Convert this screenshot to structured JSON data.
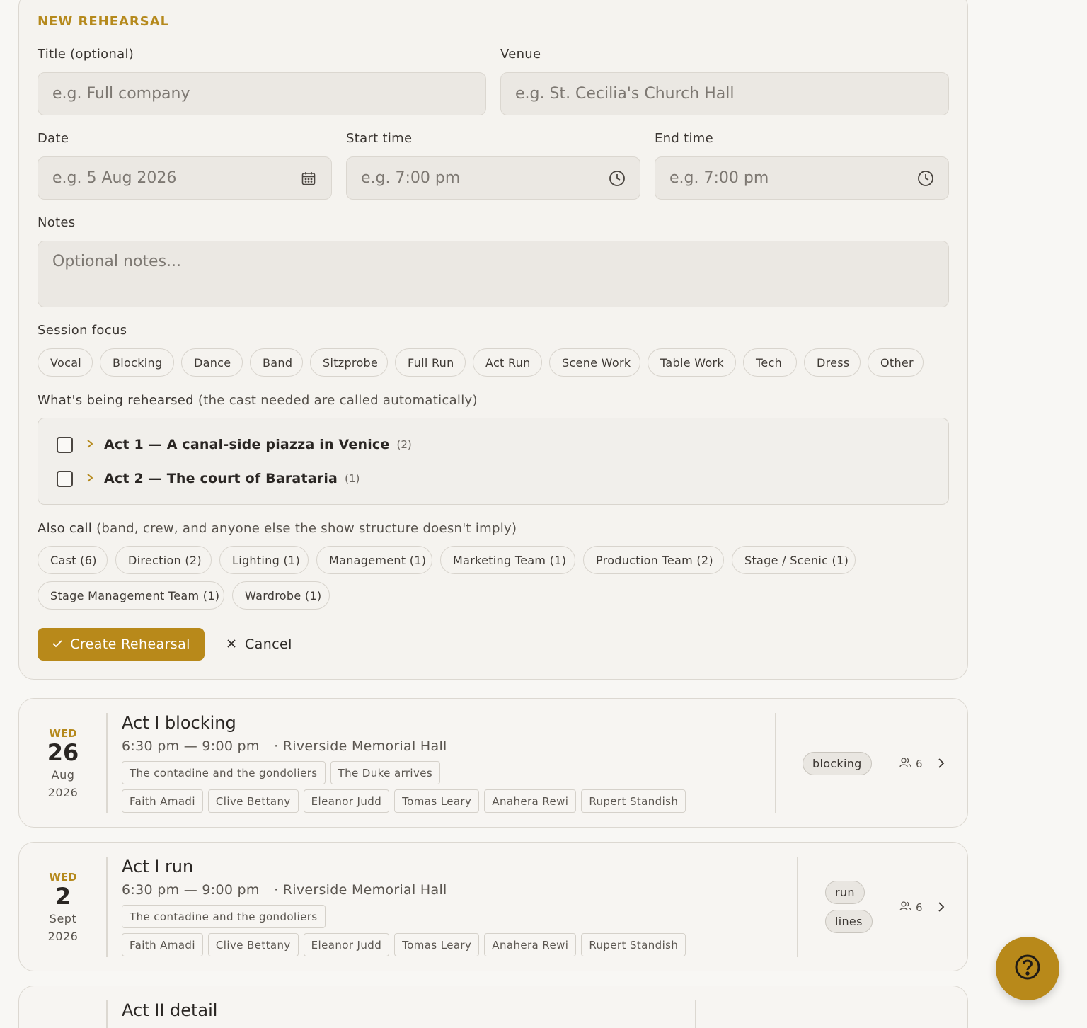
{
  "form": {
    "section_title": "NEW REHEARSAL",
    "title_label": "Title (optional)",
    "title_placeholder": "e.g. Full company",
    "venue_label": "Venue",
    "venue_placeholder": "e.g. St. Cecilia's Church Hall",
    "date_label": "Date",
    "date_placeholder": "e.g. 5 Aug 2026",
    "start_label": "Start time",
    "start_placeholder": "e.g. 7:00 pm",
    "end_label": "End time",
    "end_placeholder": "e.g. 7:00 pm",
    "notes_label": "Notes",
    "notes_placeholder": "Optional notes...",
    "focus_label": "Session focus",
    "focus_options": [
      "Vocal",
      "Blocking",
      "Dance",
      "Band",
      "Sitzprobe",
      "Full Run",
      "Act Run",
      "Scene Work",
      "Table Work",
      "Tech",
      "Dress",
      "Other"
    ],
    "rehearsed_label_main": "What's being rehearsed",
    "rehearsed_label_sub": "(the cast needed are called automatically)",
    "tree": [
      {
        "label": "Act 1 — A canal-side piazza in Venice",
        "count": "(2)"
      },
      {
        "label": "Act 2 — The court of Barataria",
        "count": "(1)"
      }
    ],
    "also_call_main": "Also call",
    "also_call_sub": "(band, crew, and anyone else the show structure doesn't imply)",
    "call_row1": [
      "Cast (6)",
      "Direction (2)",
      "Lighting (1)",
      "Management (1)",
      "Marketing Team (1)",
      "Production Team (2)",
      "Stage / Scenic (1)"
    ],
    "call_row2": [
      "Stage Management Team (1)",
      "Wardrobe (1)"
    ],
    "create_label": "Create Rehearsal",
    "cancel_label": "Cancel"
  },
  "rehearsals": [
    {
      "dow": "WED",
      "day": "26",
      "month": "Aug",
      "year": "2026",
      "title": "Act I blocking",
      "time": "6:30 pm — 9:00 pm",
      "venue": "· Riverside Memorial Hall",
      "scenes": [
        "The contadine and the gondoliers",
        "The Duke arrives"
      ],
      "people": [
        "Faith Amadi",
        "Clive Bettany",
        "Eleanor Judd",
        "Tomas Leary",
        "Anahera Rewi",
        "Rupert Standish"
      ],
      "focus": [
        "blocking"
      ],
      "count": "6"
    },
    {
      "dow": "WED",
      "day": "2",
      "month": "Sept",
      "year": "2026",
      "title": "Act I run",
      "time": "6:30 pm — 9:00 pm",
      "venue": "· Riverside Memorial Hall",
      "scenes": [
        "The contadine and the gondoliers"
      ],
      "people": [
        "Faith Amadi",
        "Clive Bettany",
        "Eleanor Judd",
        "Tomas Leary",
        "Anahera Rewi",
        "Rupert Standish"
      ],
      "focus": [
        "run",
        "lines"
      ],
      "count": "6"
    },
    {
      "title": "Act II detail"
    }
  ],
  "colors": {
    "accent": "#b8891a",
    "background": "#f8f7f4"
  },
  "icons": [
    "calendar-icon",
    "clock-icon",
    "chevron-right-icon",
    "check-icon",
    "close-icon",
    "people-icon",
    "help-icon"
  ]
}
